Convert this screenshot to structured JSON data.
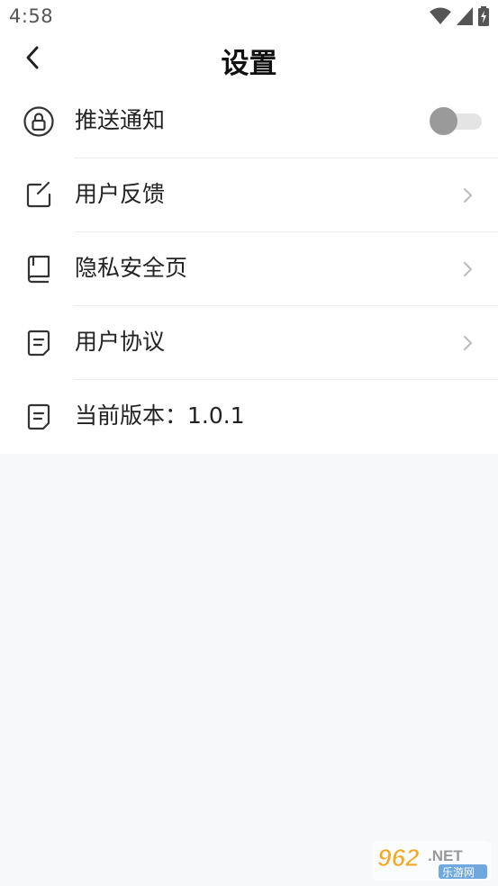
{
  "status_bar": {
    "time": "4:58",
    "icons": [
      "wifi-icon",
      "cellular-signal-icon",
      "battery-icon"
    ]
  },
  "header": {
    "title": "设置",
    "back_icon": "chevron-left-icon"
  },
  "settings": {
    "items": [
      {
        "label": "推送通知",
        "icon": "lock-circle-icon",
        "type": "toggle",
        "toggle_on": false
      },
      {
        "label": "用户反馈",
        "icon": "edit-icon",
        "type": "link"
      },
      {
        "label": "隐私安全页",
        "icon": "book-icon",
        "type": "link"
      },
      {
        "label": "用户协议",
        "icon": "document-icon",
        "type": "link"
      },
      {
        "label": "当前版本：1.0.1",
        "icon": "document-icon",
        "type": "info"
      }
    ]
  },
  "watermark": {
    "brand": "962.NET",
    "sub": "乐游网"
  },
  "colors": {
    "background": "#f7f8fa",
    "surface": "#ffffff",
    "text": "#222222",
    "divider": "#ececec",
    "toggle_knob": "#9a9a9a",
    "toggle_track": "#e4e4e4",
    "chevron": "#bbbbbb",
    "watermark_accent": "#f5a623"
  }
}
